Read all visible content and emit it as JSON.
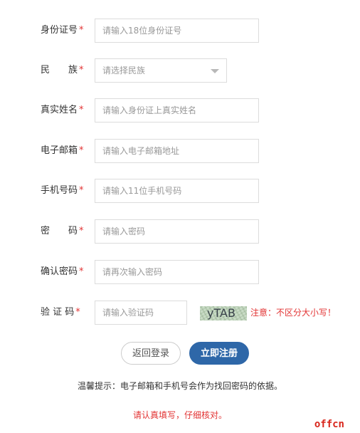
{
  "form": {
    "id_number": {
      "label": "身份证号",
      "required_mark": "*",
      "placeholder": "请输入18位身份证号"
    },
    "ethnicity": {
      "label": "民　　族",
      "required_mark": "*",
      "selected": "请选择民族"
    },
    "real_name": {
      "label": "真实姓名",
      "required_mark": "*",
      "placeholder": "请输入身份证上真实姓名"
    },
    "email": {
      "label": "电子邮箱",
      "required_mark": "*",
      "placeholder": "请输入电子邮箱地址"
    },
    "phone": {
      "label": "手机号码",
      "required_mark": "*",
      "placeholder": "请输入11位手机号码"
    },
    "password": {
      "label": "密　　码",
      "required_mark": "*",
      "placeholder": "请输入密码"
    },
    "confirm_password": {
      "label": "确认密码",
      "required_mark": "*",
      "placeholder": "请再次输入密码"
    },
    "captcha": {
      "label": "验 证 码",
      "required_mark": "*",
      "placeholder": "请输入验证码",
      "image_text": "yTAB",
      "note": "注意：不区分大小写！"
    }
  },
  "buttons": {
    "back_label": "返回登录",
    "register_label": "立即注册"
  },
  "tip": "温馨提示：电子邮箱和手机号会作为找回密码的依据。",
  "warning": "请认真填写，仔细核对。",
  "watermark": "offcn",
  "colors": {
    "required": "#e23333",
    "primary_button": "#2e67a8",
    "warning_text": "#e23333",
    "border": "#dcdcdc"
  },
  "icons": {
    "select_arrow": "chevron-down-icon"
  }
}
